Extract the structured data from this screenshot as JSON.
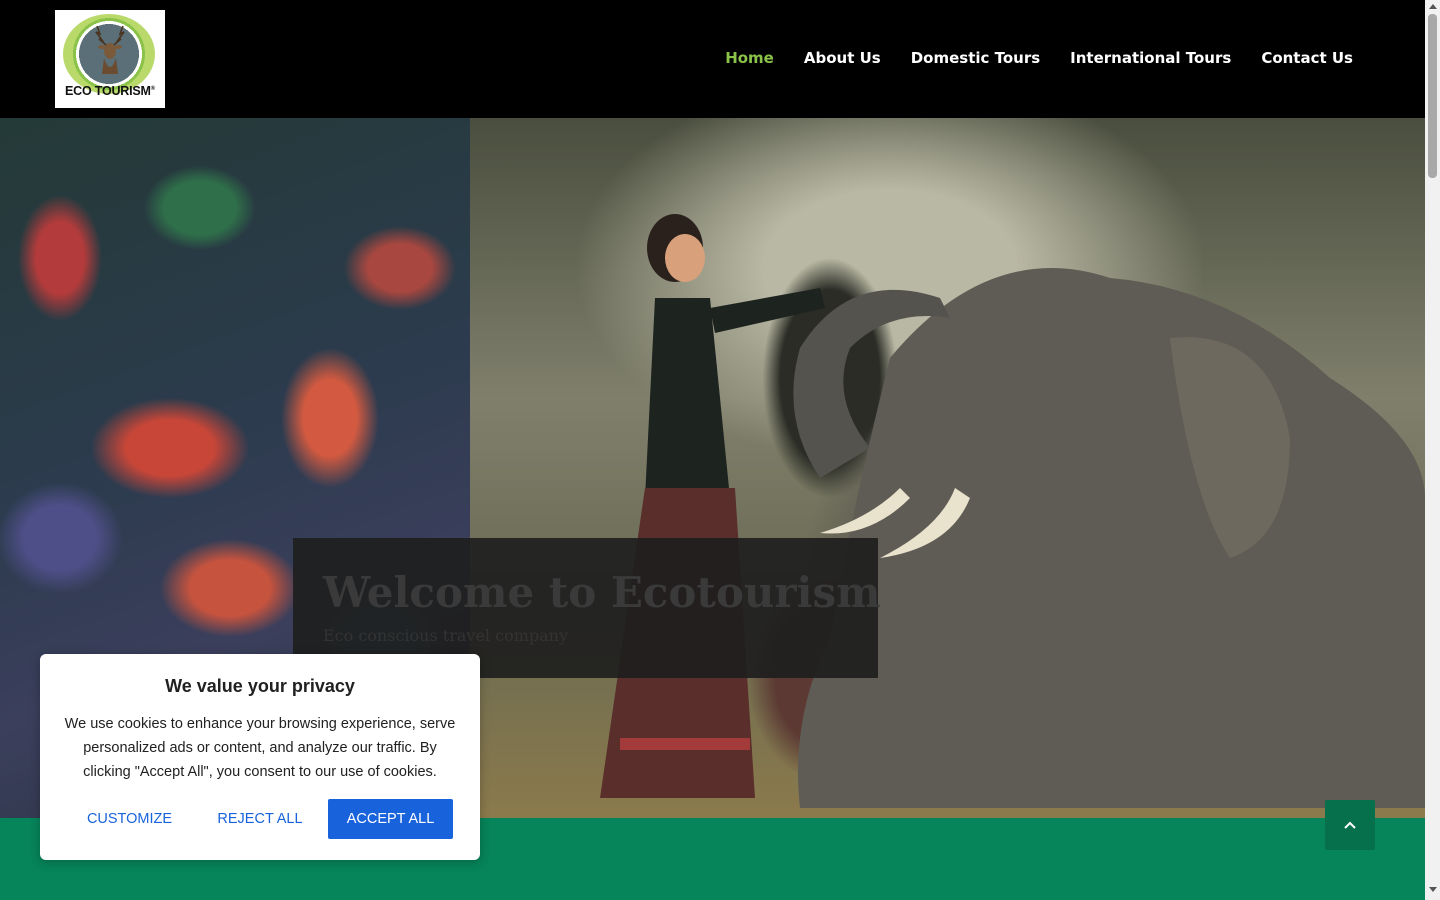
{
  "logo": {
    "text": "ECO TOURISM",
    "mark": "®",
    "icon": "deer-icon"
  },
  "nav": {
    "items": [
      {
        "label": "Home",
        "active": true
      },
      {
        "label": "About Us",
        "active": false
      },
      {
        "label": "Domestic Tours",
        "active": false
      },
      {
        "label": "International Tours",
        "active": false
      },
      {
        "label": "Contact Us",
        "active": false
      }
    ],
    "active_color": "#8bc34a"
  },
  "hero": {
    "title": "Welcome to Ecotourism",
    "subtitle": "Eco conscious travel company"
  },
  "cookie": {
    "title": "We value your privacy",
    "text": "We use cookies to enhance your browsing experience, serve personalized ads or content, and analyze our traffic. By clicking \"Accept All\", you consent to our use of cookies.",
    "customize_label": "CUSTOMIZE",
    "reject_label": "REJECT ALL",
    "accept_label": "ACCEPT ALL",
    "accent_color": "#1863dc"
  },
  "scroll_top": {
    "icon": "chevron-up-icon"
  },
  "colors": {
    "header_bg": "#000000",
    "band": "#06845a"
  }
}
